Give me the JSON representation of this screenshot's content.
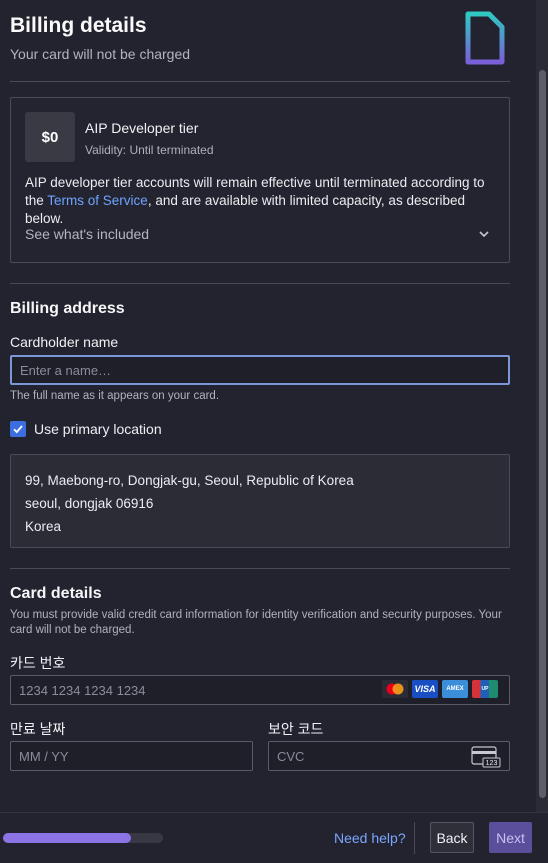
{
  "header": {
    "title": "Billing details",
    "subtitle": "Your card will not be charged"
  },
  "tier": {
    "price": "$0",
    "name": "AIP Developer tier",
    "validity": "Validity: Until terminated",
    "desc_before": "AIP developer tier accounts will remain effective until terminated according to the ",
    "tos_link": "Terms of Service",
    "desc_after": ", and are available with limited capacity, as described below.",
    "included_label": "See what's included"
  },
  "billing": {
    "section_title": "Billing address",
    "cardholder_label": "Cardholder name",
    "cardholder_placeholder": "Enter a name…",
    "cardholder_value": "",
    "cardholder_help": "The full name as it appears on your card.",
    "use_primary_label": "Use primary location",
    "use_primary_checked": true,
    "address_lines": [
      "99, Maebong-ro, Dongjak-gu, Seoul, Republic of Korea",
      "seoul, dongjak 06916",
      "Korea"
    ]
  },
  "card": {
    "section_title": "Card details",
    "help": "You must provide valid credit card information for identity verification and security purposes. Your card will not be charged.",
    "number_label": "카드 번호",
    "number_placeholder": "1234 1234 1234 1234",
    "brands": [
      "MasterCard",
      "VISA",
      "AMEX",
      "UnionPay"
    ],
    "expiry_label": "만료 날짜",
    "expiry_placeholder": "MM / YY",
    "cvc_label": "보안 코드",
    "cvc_placeholder": "CVC",
    "cvc_icon_text": "123"
  },
  "footer": {
    "progress_fraction": 0.8,
    "help_link": "Need help?",
    "back_label": "Back",
    "next_label": "Next"
  },
  "colors": {
    "accent": "#3d6ee0",
    "link": "#6ca3ff",
    "progress": "#8d74e6",
    "next_button": "#5b4f9c"
  }
}
